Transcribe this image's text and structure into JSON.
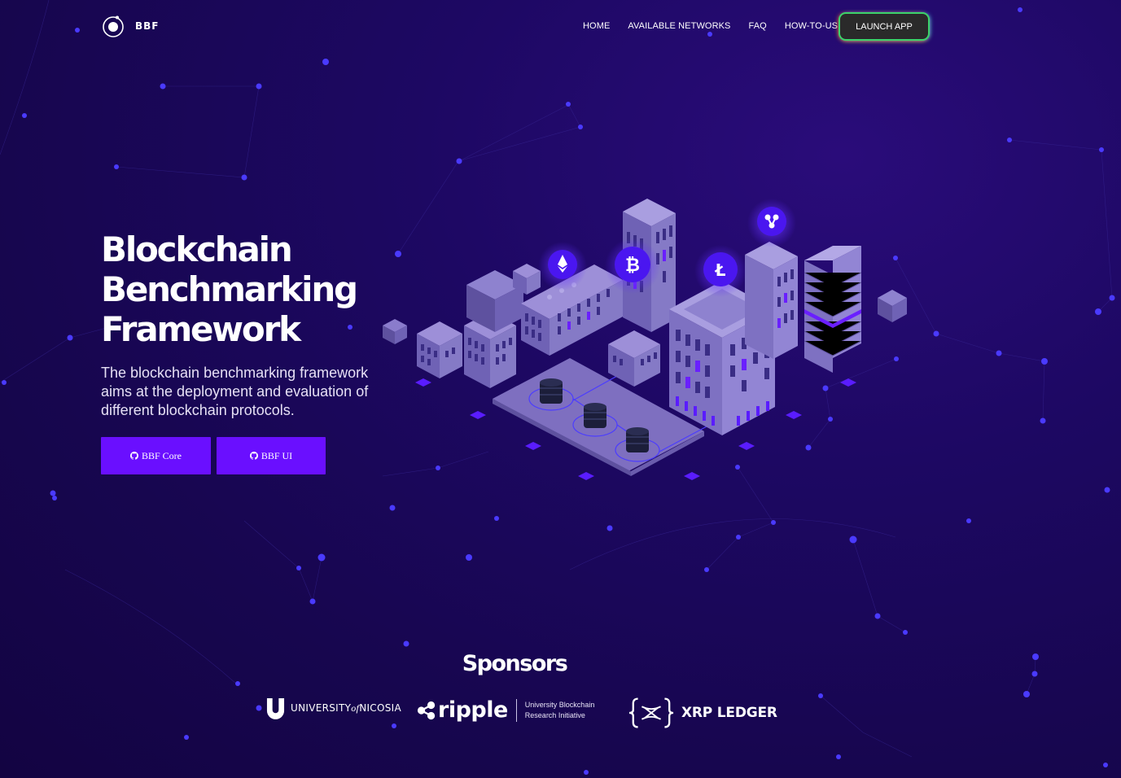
{
  "brand": {
    "name": "BBF"
  },
  "nav": {
    "items": [
      "HOME",
      "AVAILABLE NETWORKS",
      "FAQ",
      "HOW-TO-USE"
    ],
    "launch_label": "LAUNCH APP"
  },
  "hero": {
    "title_lines": [
      "Blockchain",
      "Benchmarking",
      "Framework"
    ],
    "subtitle": "The blockchain benchmarking framework aims at the deployment and evaluation of different blockchain protocols.",
    "buttons": [
      {
        "label": "BBF Core",
        "icon": "github-icon"
      },
      {
        "label": "BBF UI",
        "icon": "github-icon"
      }
    ],
    "illustration_coins": [
      "ethereum-icon",
      "bitcoin-icon",
      "litecoin-icon",
      "ripple-icon"
    ]
  },
  "sponsors": {
    "title": "Sponsors",
    "items": [
      {
        "name": "UNIVERSITY",
        "name_italic": "of",
        "name_tail": "NICOSIA",
        "icon": "unic-shield-icon"
      },
      {
        "name": "ripple",
        "subtitle_lines": [
          "University Blockchain",
          "Research Initiative"
        ],
        "icon": "ripple-logo-icon"
      },
      {
        "name": "XRP LEDGER",
        "icon": "xrp-ledger-icon"
      }
    ]
  },
  "colors": {
    "background": "#1d0863",
    "accent": "#6a0fff",
    "coin": "#4a16f0",
    "dots": "#4a3aff"
  }
}
